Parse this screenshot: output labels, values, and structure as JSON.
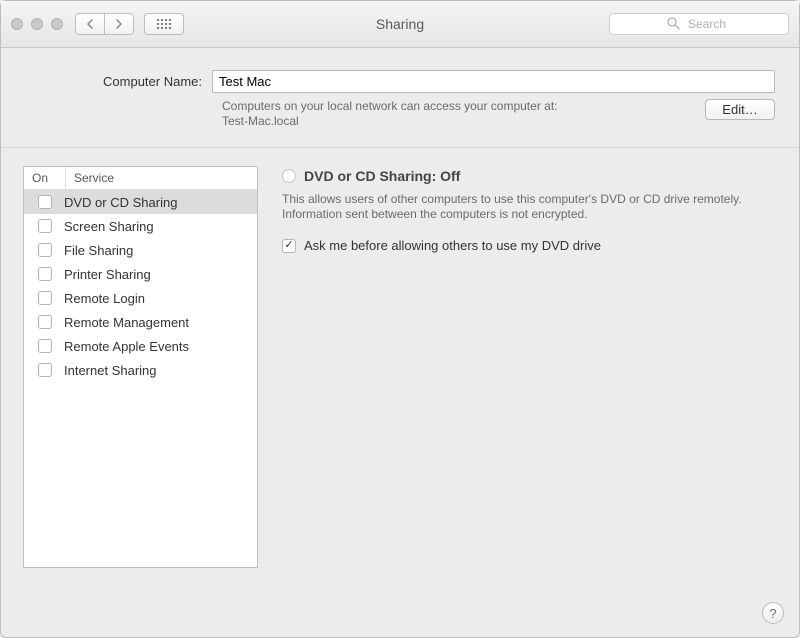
{
  "window": {
    "title": "Sharing",
    "search_placeholder": "Search"
  },
  "computer_name": {
    "label": "Computer Name:",
    "value": "Test Mac",
    "description_line1": "Computers on your local network can access your computer at:",
    "description_line2": "Test-Mac.local",
    "edit_label": "Edit…"
  },
  "services": {
    "col_on": "On",
    "col_service": "Service",
    "items": [
      {
        "label": "DVD or CD Sharing",
        "checked": false,
        "selected": true
      },
      {
        "label": "Screen Sharing",
        "checked": false,
        "selected": false
      },
      {
        "label": "File Sharing",
        "checked": false,
        "selected": false
      },
      {
        "label": "Printer Sharing",
        "checked": false,
        "selected": false
      },
      {
        "label": "Remote Login",
        "checked": false,
        "selected": false
      },
      {
        "label": "Remote Management",
        "checked": false,
        "selected": false
      },
      {
        "label": "Remote Apple Events",
        "checked": false,
        "selected": false
      },
      {
        "label": "Internet Sharing",
        "checked": false,
        "selected": false
      }
    ]
  },
  "detail": {
    "title": "DVD or CD Sharing: Off",
    "description": "This allows users of other computers to use this computer's DVD or CD drive remotely. Information sent between the computers is not encrypted.",
    "option_ask_before": {
      "label": "Ask me before allowing others to use my DVD drive",
      "checked": true
    }
  },
  "help_label": "?"
}
